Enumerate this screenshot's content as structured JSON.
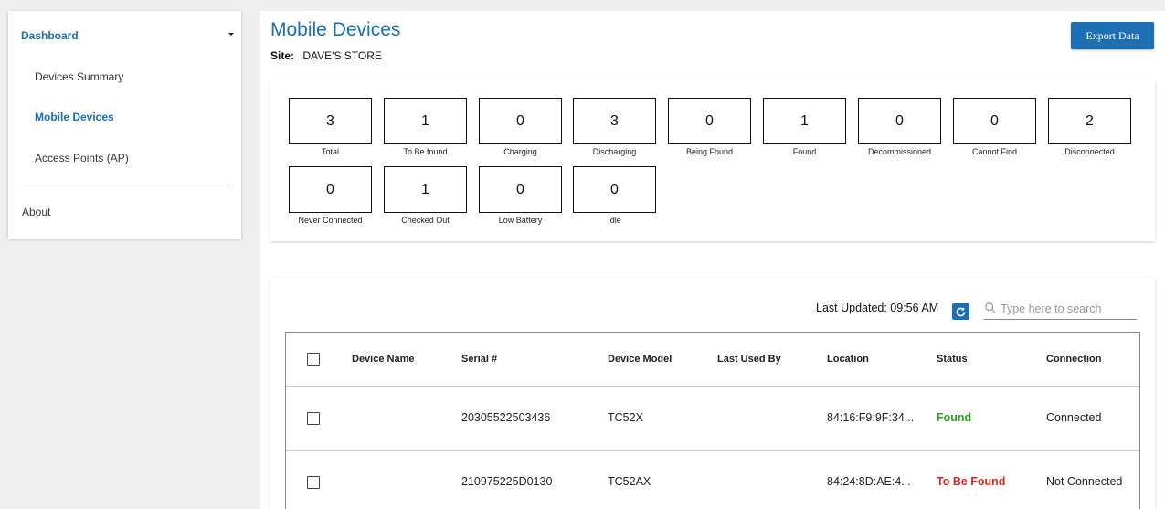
{
  "sidebar": {
    "dashboard_label": "Dashboard",
    "items": [
      {
        "label": "Devices Summary"
      },
      {
        "label": "Mobile Devices"
      },
      {
        "label": "Access Points (AP)"
      }
    ],
    "about_label": "About"
  },
  "header": {
    "title": "Mobile Devices",
    "site_label": "Site:",
    "site_value": "DAVE'S STORE",
    "export_label": "Export Data"
  },
  "summary": {
    "stats": [
      {
        "value": "3",
        "label": "Total"
      },
      {
        "value": "1",
        "label": "To Be found"
      },
      {
        "value": "0",
        "label": "Charging"
      },
      {
        "value": "3",
        "label": "Discharging"
      },
      {
        "value": "0",
        "label": "Being Found"
      },
      {
        "value": "1",
        "label": "Found"
      },
      {
        "value": "0",
        "label": "Decommissioned"
      },
      {
        "value": "0",
        "label": "Cannot Find"
      },
      {
        "value": "2",
        "label": "Disconnected"
      },
      {
        "value": "0",
        "label": "Never Connected"
      },
      {
        "value": "1",
        "label": "Checked Out"
      },
      {
        "value": "0",
        "label": "Low Battery"
      },
      {
        "value": "0",
        "label": "Idle"
      }
    ]
  },
  "table": {
    "last_updated": "Last Updated: 09:56 AM",
    "search_placeholder": "Type here to search",
    "columns": [
      "Device Name",
      "Serial #",
      "Device Model",
      "Last Used By",
      "Location",
      "Status",
      "Connection"
    ],
    "rows": [
      {
        "device_name": "",
        "serial": "20305522503436",
        "model": "TC52X",
        "last_used_by": "",
        "location": "84:16:F9:9F:34...",
        "status": "Found",
        "connection": "Connected"
      },
      {
        "device_name": "",
        "serial": "210975225D0130",
        "model": "TC52AX",
        "last_used_by": "",
        "location": "84:24:8D:AE:4...",
        "status": "To Be Found",
        "connection": "Not Connected"
      }
    ]
  },
  "colors": {
    "accent": "#1a6fb0",
    "button": "#1d6fb3",
    "status_found": "#2aa21a",
    "status_to_be_found": "#e0251b"
  }
}
